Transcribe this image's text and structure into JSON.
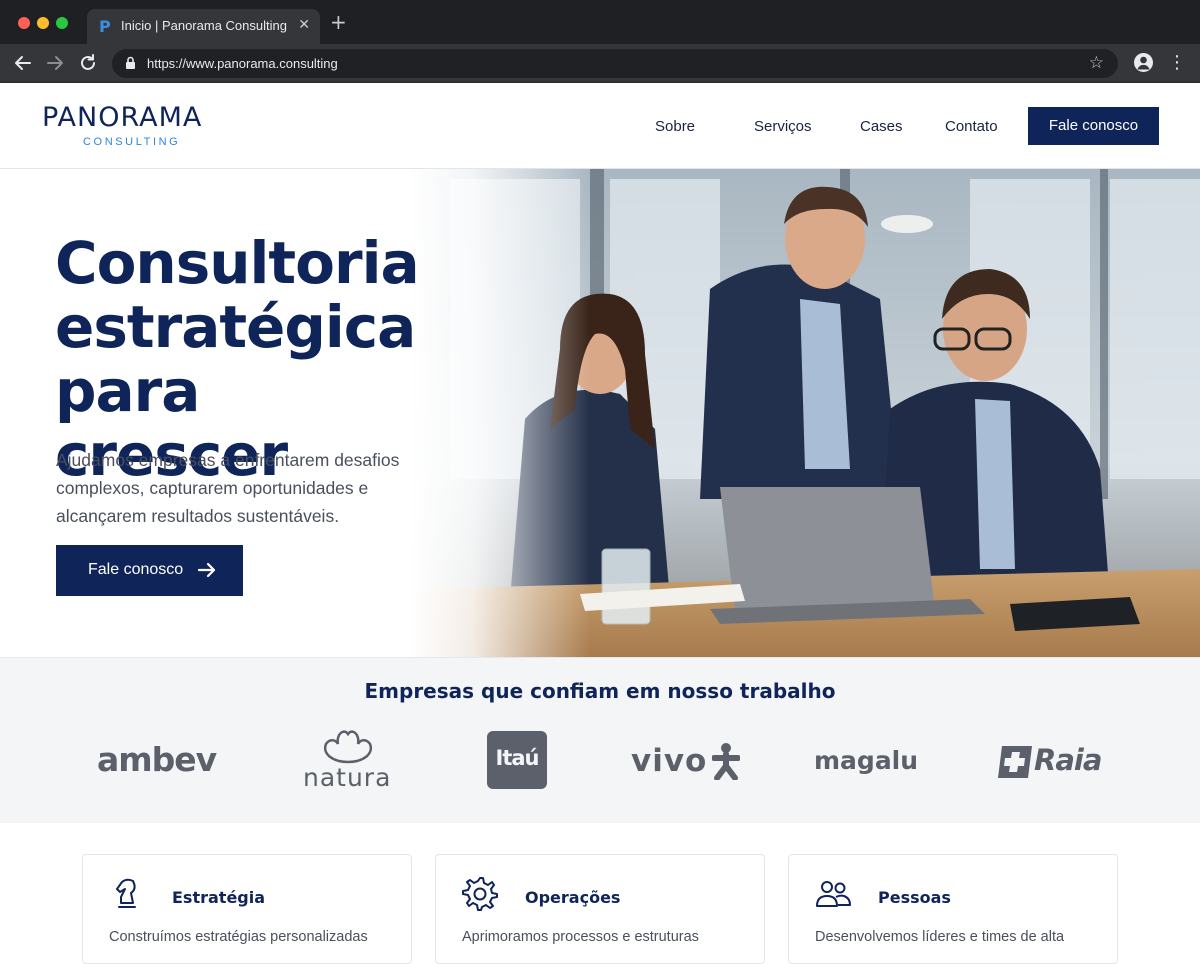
{
  "browser": {
    "tab_title": "Inicio | Panorama Consulting",
    "tab_favicon": "P",
    "url": "https://www.panorama.consulting",
    "icons": [
      "back-icon",
      "forward-icon",
      "reload-icon",
      "lock-icon",
      "star-icon",
      "profile-icon",
      "menu-icon",
      "close-icon",
      "new-tab-icon"
    ]
  },
  "header": {
    "logo_main": "PANORAMA",
    "logo_sub": "CONSULTING",
    "nav": [
      "Sobre",
      "Serviços",
      "Cases",
      "Contato"
    ],
    "cta": "Fale conosco"
  },
  "hero": {
    "title_lines": [
      "Consultoria",
      "estratégica",
      "para crescer"
    ],
    "subtitle": "Ajudamos empresas a enfrentarem desafios complexos, capturarem oportunidades e alcançarem resultados sustentáveis.",
    "cta": "Fale conosco",
    "cta_icon": "arrow-right-icon"
  },
  "clients": {
    "title": "Empresas que confiam em nosso trabalho",
    "logos": [
      "ambev",
      "natura",
      "Itaú",
      "vivo",
      "magalu",
      "Raia"
    ]
  },
  "services": [
    {
      "icon": "chess-knight-icon",
      "title": "Estratégia",
      "text": "Construímos estratégias personalizadas"
    },
    {
      "icon": "gear-icon",
      "title": "Operações",
      "text": "Aprimoramos processos e estruturas"
    },
    {
      "icon": "people-icon",
      "title": "Pessoas",
      "text": "Desenvolvemos líderes e times de alta"
    }
  ],
  "colors": {
    "brand_navy": "#0f2459",
    "brand_blue": "#2f86d6",
    "chrome_dark": "#1f2023",
    "logo_gray": "#5b606b"
  }
}
